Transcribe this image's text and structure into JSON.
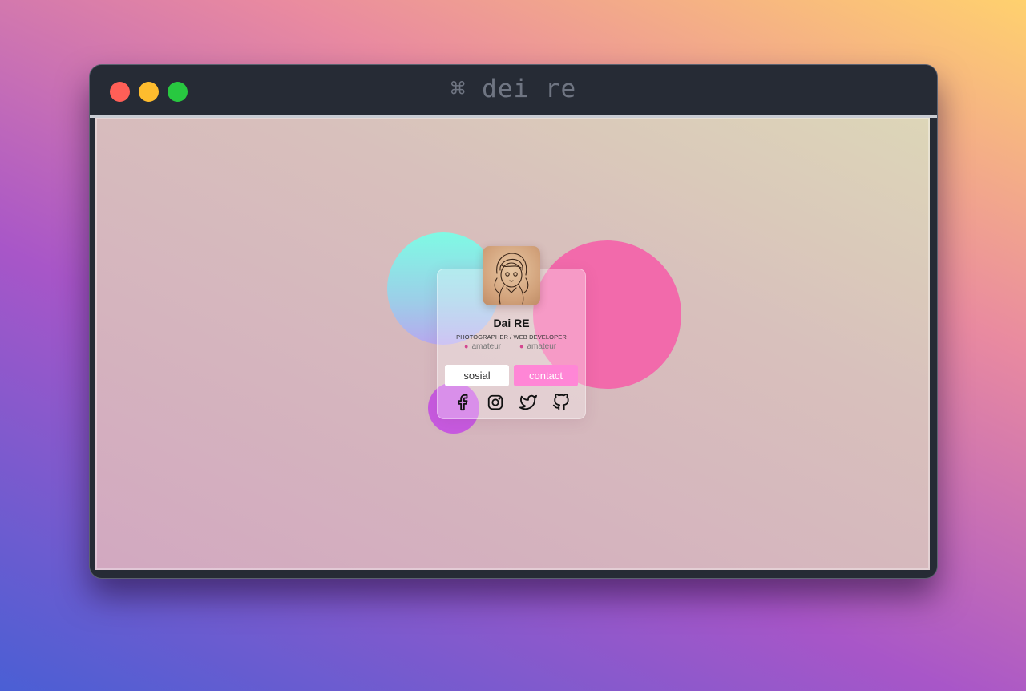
{
  "window": {
    "title": "⌘ dei re"
  },
  "profile": {
    "name": "Dai RE",
    "role": "PHOTOGRAPHER / WEB DEVELOPER",
    "tags": [
      "amateur",
      "amateur"
    ],
    "buttons": {
      "sosial": "sosial",
      "contact": "contact"
    },
    "social_icons": [
      "facebook-icon",
      "instagram-icon",
      "twitter-icon",
      "github-icon"
    ]
  },
  "colors": {
    "accent_pink": "#ff86d6",
    "blob_pink": "#f26aab",
    "blob_cyan": "#7ffae4",
    "blob_purple": "#c75ae0"
  }
}
